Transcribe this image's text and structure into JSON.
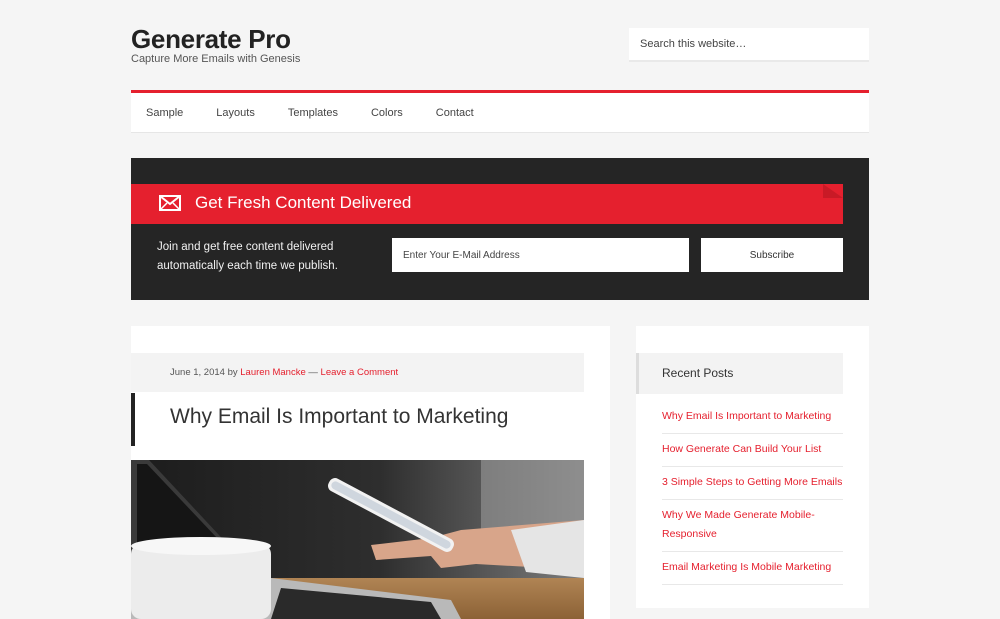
{
  "header": {
    "title": "Generate Pro",
    "description": "Capture More Emails with Genesis",
    "search_placeholder": "Search this website…"
  },
  "nav": {
    "items": [
      "Sample",
      "Layouts",
      "Templates",
      "Colors",
      "Contact"
    ]
  },
  "newsletter": {
    "icon": "envelope-icon",
    "title": "Get Fresh Content Delivered",
    "text": "Join and get free content delivered automatically each time we publish.",
    "email_placeholder": "Enter Your E-Mail Address",
    "subscribe_label": "Subscribe"
  },
  "post": {
    "date": "June 1, 2014",
    "by": "by",
    "author": "Lauren Mancke",
    "separator": "—",
    "comment_link": "Leave a Comment",
    "title": "Why Email Is Important to Marketing",
    "image": "photo of hand holding phone above laptop"
  },
  "sidebar": {
    "widget_title": "Recent Posts",
    "posts": [
      "Why Email Is Important to Marketing",
      "How Generate Can Build Your List",
      "3 Simple Steps to Getting More Emails",
      "Why We Made Generate Mobile-Responsive",
      "Email Marketing Is Mobile Marketing"
    ]
  },
  "colors": {
    "accent": "#e5202e",
    "dark": "#252525",
    "background": "#f5f5f5"
  }
}
